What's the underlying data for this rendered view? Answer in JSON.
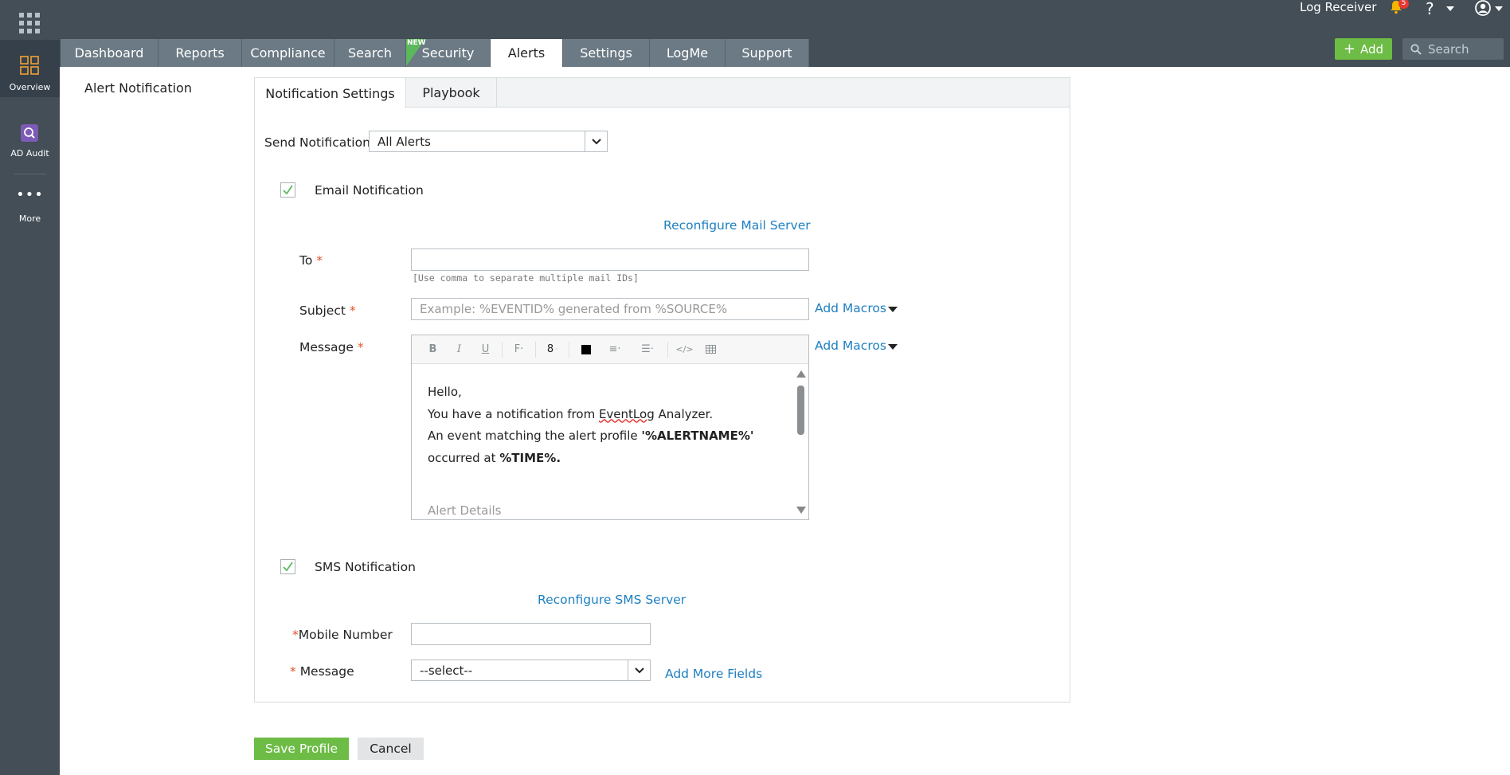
{
  "header": {
    "log_receiver": "Log Receiver",
    "notification_count": "5",
    "help_label": "?",
    "add_label": "Add",
    "search_placeholder": "Search"
  },
  "tabs": [
    {
      "label": "Dashboard"
    },
    {
      "label": "Reports"
    },
    {
      "label": "Compliance"
    },
    {
      "label": "Search"
    },
    {
      "label": "Security",
      "badge": "NEW"
    },
    {
      "label": "Alerts"
    },
    {
      "label": "Settings"
    },
    {
      "label": "LogMe"
    },
    {
      "label": "Support"
    }
  ],
  "leftnav": {
    "overview": "Overview",
    "ad_audit": "AD Audit",
    "more": "More"
  },
  "page": {
    "title": "Alert Notification"
  },
  "panel": {
    "tabs": [
      "Notification Settings",
      "Playbook"
    ],
    "send_notification_label": "Send Notification",
    "send_notification_value": "All Alerts",
    "email": {
      "label": "Email Notification",
      "checked": true,
      "reconfigure_link": "Reconfigure Mail Server",
      "to_label": "To",
      "to_value": "",
      "to_hint": "[Use comma to separate multiple mail IDs]",
      "subject_label": "Subject",
      "subject_placeholder": "Example: %EVENTID% generated from %SOURCE%",
      "message_label": "Message",
      "add_macros": "Add Macros",
      "font_size": "8",
      "body": {
        "line1": "Hello,",
        "line2_pre": "You have a notification from ",
        "line2_brand": "EventLog",
        "line2_post": " Analyzer.",
        "line3_pre": "An event matching the alert profile ",
        "line3_bold": "'%ALERTNAME%'",
        "line4_pre": "occurred at ",
        "line4_bold": "%TIME%.",
        "line5": "Alert Details"
      }
    },
    "sms": {
      "label": "SMS Notification",
      "checked": true,
      "reconfigure_link": "Reconfigure SMS Server",
      "mobile_label": "Mobile Number",
      "mobile_value": "",
      "message_label": "Message",
      "message_value": "--select--",
      "add_more_fields": "Add More Fields"
    },
    "required_mark": "*"
  },
  "actions": {
    "save": "Save Profile",
    "cancel": "Cancel"
  },
  "colors": {
    "topbar": "#434e56",
    "accent_green": "#6cbc45",
    "link_blue": "#1e7fc0",
    "required_orange": "#e5542b"
  }
}
